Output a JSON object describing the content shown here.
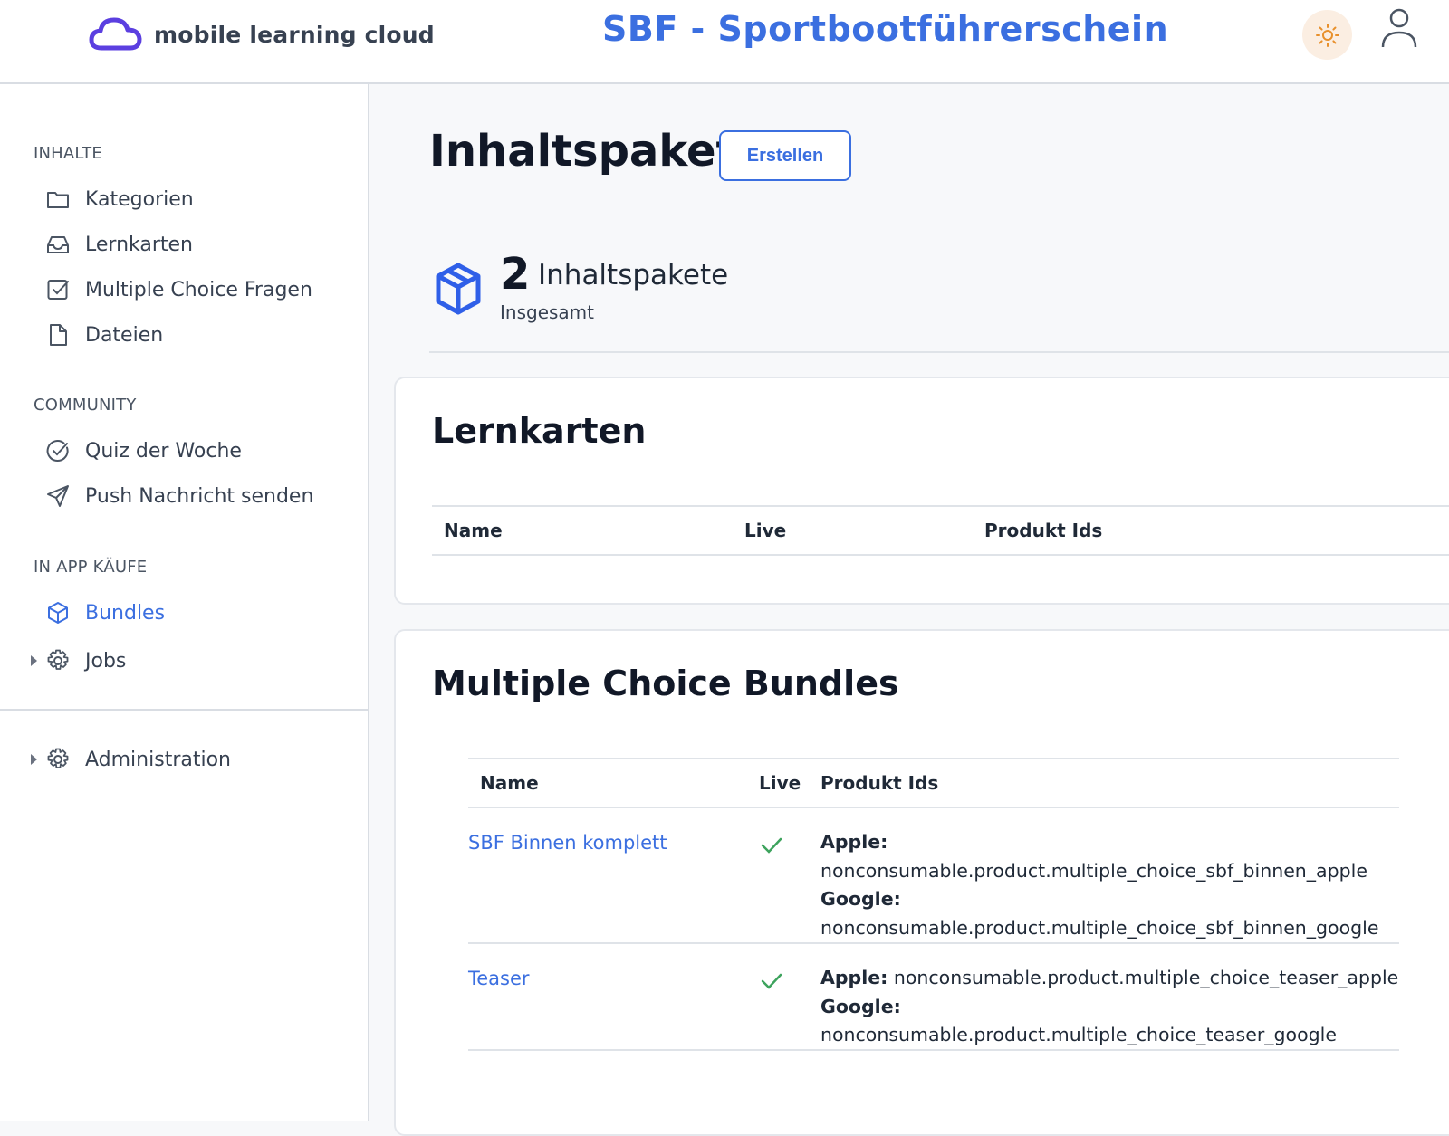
{
  "header": {
    "brand_name": "mobile learning cloud",
    "app_title": "SBF - Sportbootführerschein",
    "icons": {
      "brand": "cloud-logo-icon",
      "theme": "sun-icon",
      "user": "user-icon"
    },
    "colors": {
      "accent": "#3b6fe0",
      "logo": "#5b3fe0",
      "theme_bg": "#fbeee2",
      "theme_icon": "#e8902c"
    }
  },
  "sidebar": {
    "sections": [
      {
        "title": "INHALTE",
        "items": [
          {
            "label": "Kategorien",
            "icon": "folder-icon"
          },
          {
            "label": "Lernkarten",
            "icon": "inbox-icon"
          },
          {
            "label": "Multiple Choice Fragen",
            "icon": "checkbox-icon"
          },
          {
            "label": "Dateien",
            "icon": "file-icon"
          }
        ]
      },
      {
        "title": "COMMUNITY",
        "items": [
          {
            "label": "Quiz der Woche",
            "icon": "check-circle-icon"
          },
          {
            "label": "Push Nachricht senden",
            "icon": "send-icon"
          }
        ]
      },
      {
        "title": "IN APP KÄUFE",
        "items": [
          {
            "label": "Bundles",
            "icon": "cube-icon",
            "active": true
          },
          {
            "label": "Jobs",
            "icon": "gear-icon"
          }
        ]
      }
    ],
    "administration": {
      "label": "Administration",
      "icon": "gear-icon"
    }
  },
  "main": {
    "page_title": "Inhaltspakete",
    "create_label": "Erstellen",
    "stat": {
      "count": "2",
      "label": "Inhaltspakete",
      "sub": "Insgesamt",
      "icon": "cube-icon"
    },
    "lernkarten": {
      "title": "Lernkarten",
      "columns": [
        "Name",
        "Live",
        "Produkt Ids"
      ]
    },
    "mc_bundles": {
      "title": "Multiple Choice Bundles",
      "columns": [
        "Name",
        "Live",
        "Produkt Ids"
      ],
      "rows": [
        {
          "name": "SBF Binnen komplett",
          "live": true,
          "apple_label": "Apple:",
          "apple": "nonconsumable.product.multiple_choice_sbf_binnen_apple",
          "google_label": "Google:",
          "google": "nonconsumable.product.multiple_choice_sbf_binnen_google"
        },
        {
          "name": "Teaser",
          "live": true,
          "apple_label": "Apple:",
          "apple": "nonconsumable.product.multiple_choice_teaser_apple",
          "google_label": "Google:",
          "google": "nonconsumable.product.multiple_choice_teaser_google"
        }
      ]
    }
  }
}
